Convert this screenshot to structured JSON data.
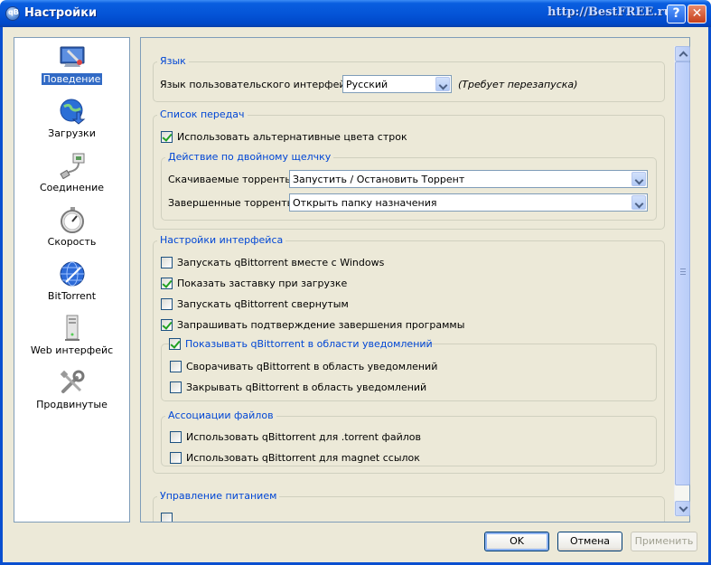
{
  "window": {
    "title": "Настройки",
    "app_icon_text": "qB",
    "watermark": "http://BestFREE.ru",
    "help_glyph": "?",
    "close_glyph": "✕"
  },
  "sidebar": {
    "items": [
      {
        "label": "Поведение",
        "icon": "monitor-wrench-icon",
        "selected": true
      },
      {
        "label": "Загрузки",
        "icon": "globe-download-icon"
      },
      {
        "label": "Соединение",
        "icon": "network-plug-icon"
      },
      {
        "label": "Скорость",
        "icon": "stopwatch-icon"
      },
      {
        "label": "BitTorrent",
        "icon": "bittorrent-globe-icon"
      },
      {
        "label": "Web интерфейс",
        "icon": "server-tower-icon"
      },
      {
        "label": "Продвинутые",
        "icon": "tools-icon"
      }
    ]
  },
  "language": {
    "group_title": "Язык",
    "label": "Язык пользовательского интерфейса:",
    "value": "Русский",
    "note": "(Требует перезапуска)"
  },
  "transfer_list": {
    "group_title": "Список передач",
    "alt_colors": {
      "label": "Использовать альтернативные цвета строк",
      "checked": true
    },
    "double_click": {
      "group_title": "Действие по двойному щелчку",
      "downloading_label": "Скачиваемые торренты:",
      "downloading_value": "Запустить / Остановить Торрент",
      "completed_label": "Завершенные торренты:",
      "completed_value": "Открыть папку назначения"
    }
  },
  "interface": {
    "group_title": "Настройки интерфейса",
    "start_with_windows": {
      "label": "Запускать qBittorrent вместе с Windows",
      "checked": false
    },
    "splash": {
      "label": "Показать заставку при загрузке",
      "checked": true
    },
    "start_minimized": {
      "label": "Запускать qBittorrent свернутым",
      "checked": false
    },
    "confirm_exit": {
      "label": "Запрашивать подтверждение завершения программы",
      "checked": true
    },
    "tray": {
      "label": "Показывать qBittorrent в области уведомлений",
      "checked": true,
      "minimize_to_tray": {
        "label": "Сворачивать qBittorrent в область уведомлений",
        "checked": false
      },
      "close_to_tray": {
        "label": "Закрывать qBittorrent в область уведомлений",
        "checked": false
      }
    },
    "associations": {
      "group_title": "Ассоциации файлов",
      "torrent_files": {
        "label": "Использовать qBittorrent для .torrent файлов",
        "checked": false
      },
      "magnet_links": {
        "label": "Использовать qBittorrent для magnet ссылок",
        "checked": false
      }
    }
  },
  "power": {
    "group_title": "Управление питанием"
  },
  "buttons": {
    "ok": "OK",
    "cancel": "Отмена",
    "apply": "Применить"
  }
}
